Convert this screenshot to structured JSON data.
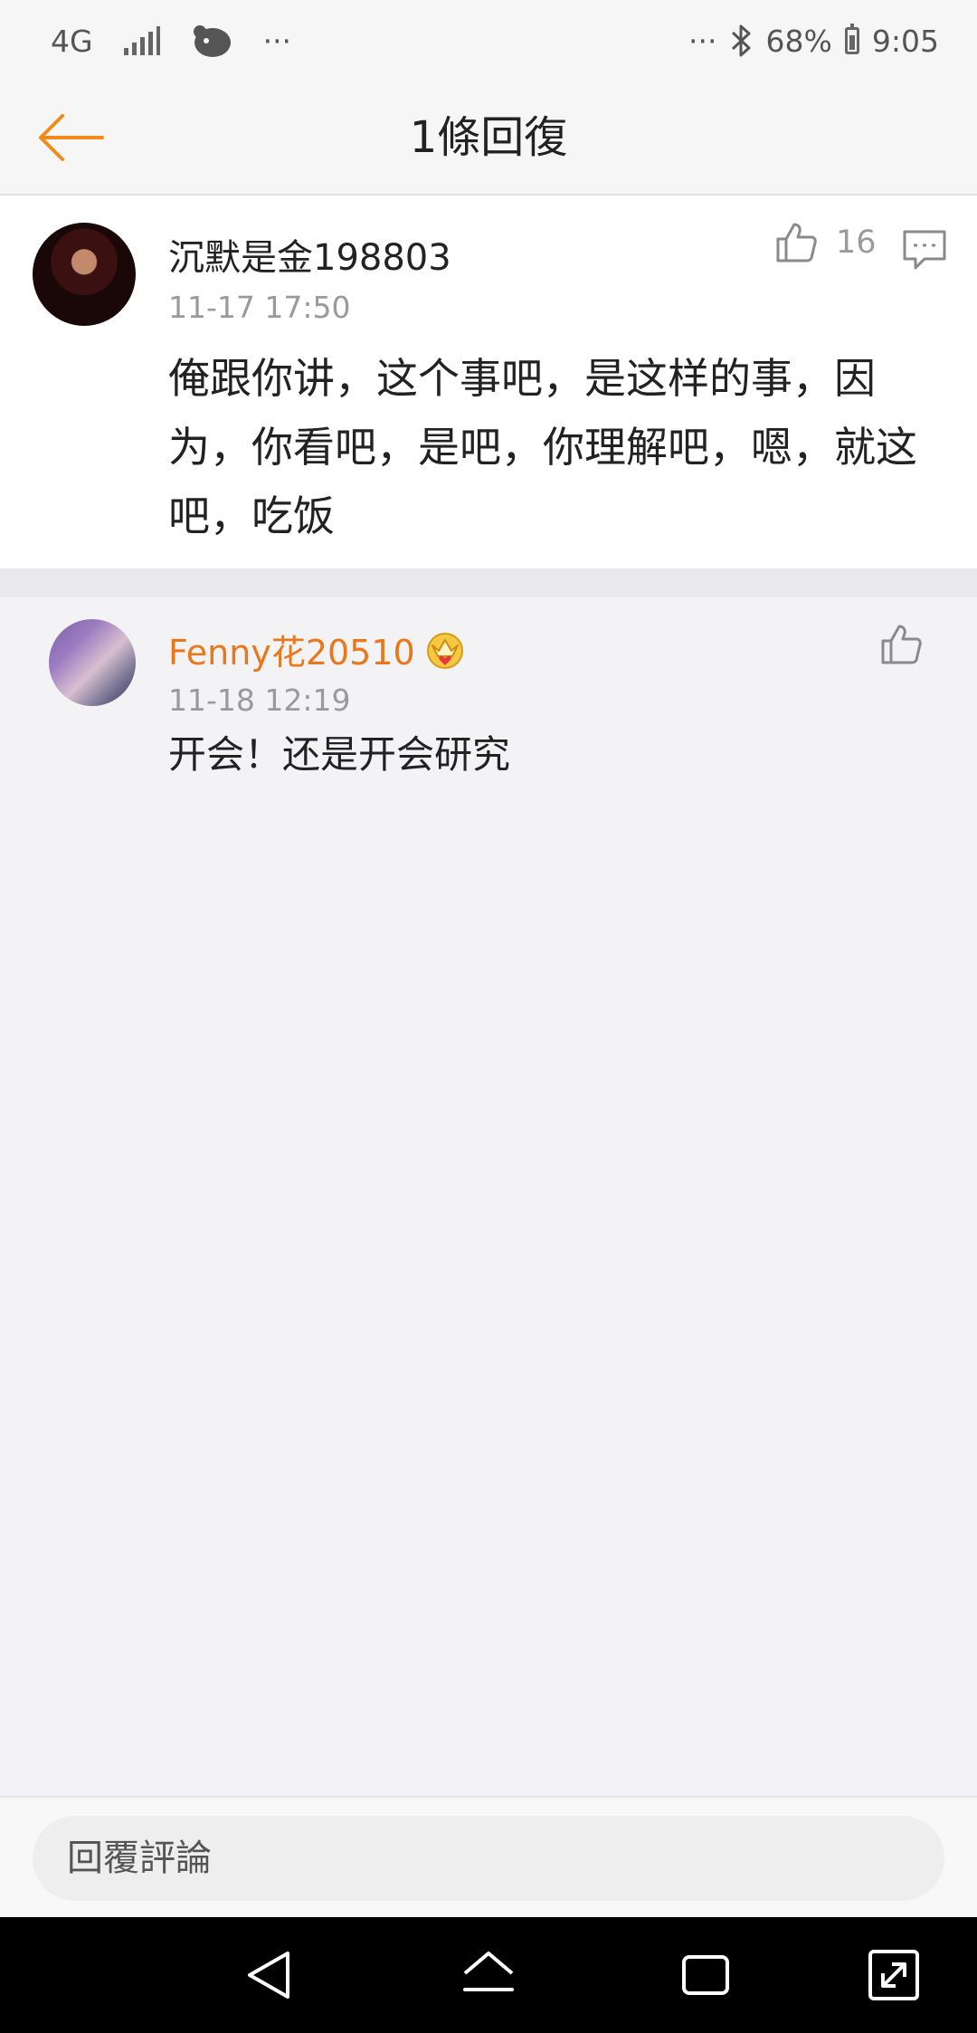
{
  "status_bar": {
    "network": "4G",
    "more_left": "···",
    "more_right": "···",
    "battery": "68%",
    "time": "9:05"
  },
  "header": {
    "title": "1條回復",
    "back_icon": "back-arrow-icon",
    "accent": "#f08c1a"
  },
  "main_comment": {
    "username": "沉默是金198803",
    "time": "11-17 17:50",
    "like_count": "16",
    "text": "俺跟你讲，这个事吧，是这样的事，因为，你看吧，是吧，你理解吧，嗯，就这吧，吃饭"
  },
  "reply": {
    "username": "Fenny花20510",
    "badge_icon": "crown-icon",
    "time": "11-18 12:19",
    "text": "开会！还是开会研究",
    "username_color": "#e8781c"
  },
  "reply_bar": {
    "placeholder": "回覆評論"
  }
}
